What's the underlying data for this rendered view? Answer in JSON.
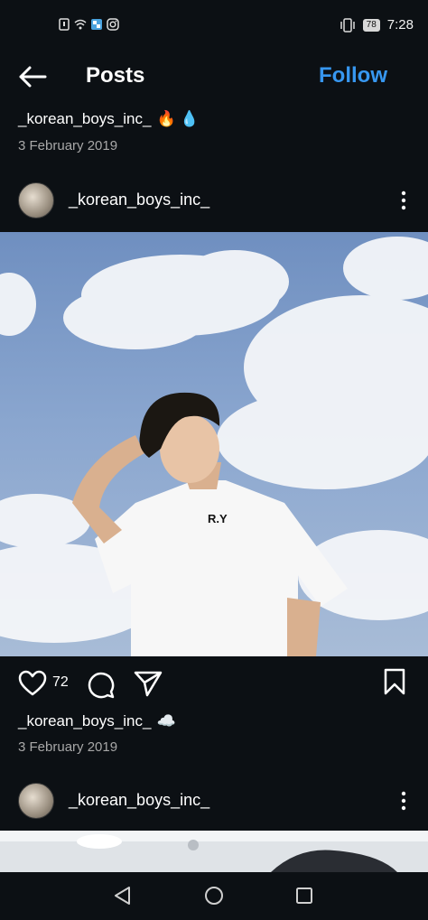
{
  "status": {
    "time": "7:28",
    "battery": "78",
    "icons": [
      "sim-icon",
      "wifi-icon",
      "app-notification-icon",
      "instagram-icon",
      "vibrate-icon",
      "battery-icon"
    ]
  },
  "header": {
    "title": "Posts",
    "follow_label": "Follow"
  },
  "posts": [
    {
      "caption_user": "_korean_boys_inc_",
      "caption_emoji": "🔥 💧",
      "date": "3 February 2019",
      "username": "_korean_boys_inc_"
    },
    {
      "caption_user": "_korean_boys_inc_",
      "caption_emoji": "☁️",
      "date": "3 February 2019",
      "username": "_korean_boys_inc_"
    }
  ],
  "post_actions": {
    "like_count": "72"
  },
  "shirt_text": "R.Y",
  "navbar": {
    "icons": [
      "back-nav-icon",
      "home-nav-icon",
      "recents-nav-icon"
    ]
  }
}
